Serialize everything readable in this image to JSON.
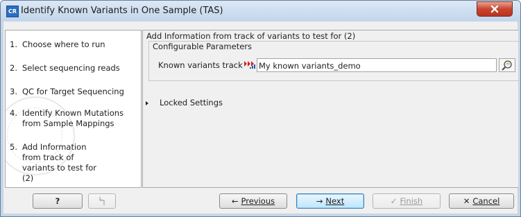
{
  "window": {
    "app_icon_text": "CR",
    "title": "Identify Known Variants in One Sample (TAS)",
    "close_symbol": "x"
  },
  "steps": [
    {
      "num": "1.",
      "label": "Choose where to run"
    },
    {
      "num": "2.",
      "label": "Select sequencing reads"
    },
    {
      "num": "3.",
      "label": "QC for Target Sequencing"
    },
    {
      "num": "4.",
      "label": "Identify Known Mutations from Sample Mappings"
    },
    {
      "num": "5.",
      "label": "Add Information from track of variants to test for (2)"
    }
  ],
  "panel": {
    "section_title": "Add Information from track of variants to test for (2)",
    "group_title": "Configurable Parameters",
    "param_label": "Known variants track",
    "param_value": "My known variants_demo",
    "track_icon": "variant-track-icon",
    "browse_icon": "browse-folder-icon",
    "locked_label": "Locked Settings"
  },
  "buttons": {
    "help": "?",
    "reset_icon": "reset-icon",
    "previous": "Previous",
    "next": "Next",
    "finish": "Finish",
    "cancel": "Cancel"
  },
  "colors": {
    "title_bar": "#c9dbef",
    "close_button": "#c9452f",
    "default_button": "#bee6fd",
    "track_icon_red": "#c8252b",
    "track_icon_blue": "#2c5aa0"
  }
}
